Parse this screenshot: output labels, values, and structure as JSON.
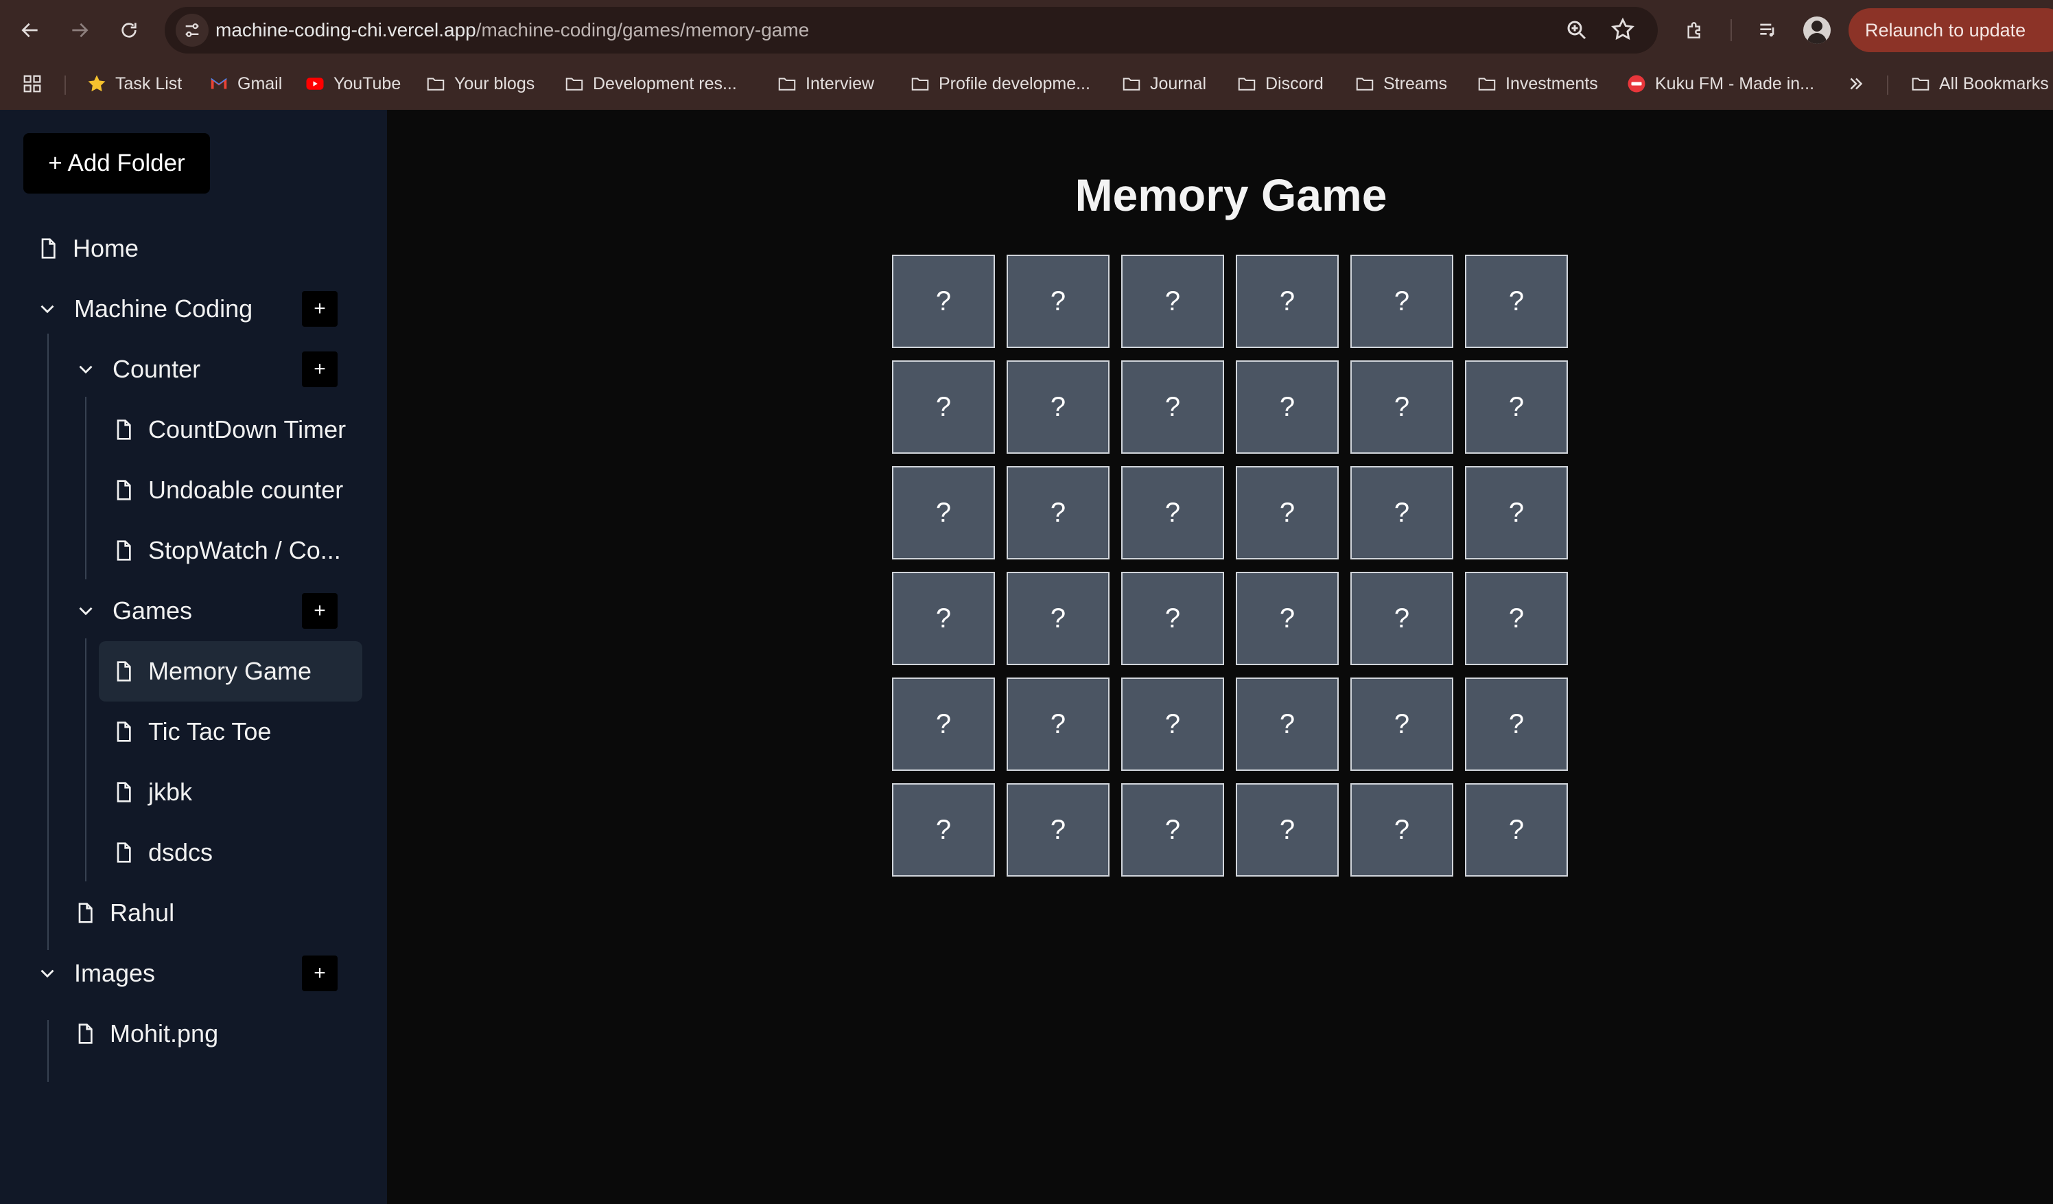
{
  "browser": {
    "url_host": "machine-coding-chi.vercel.app",
    "url_path": "/machine-coding/games/memory-game",
    "relaunch_label": "Relaunch to update",
    "bookmarks": [
      {
        "label": "Task List",
        "icon": "star-icon"
      },
      {
        "label": "Gmail",
        "icon": "gmail-icon"
      },
      {
        "label": "YouTube",
        "icon": "youtube-icon"
      },
      {
        "label": "Your blogs",
        "icon": "folder-icon"
      },
      {
        "label": "Development res...",
        "icon": "folder-icon"
      },
      {
        "label": "Interview",
        "icon": "folder-icon"
      },
      {
        "label": "Profile developme...",
        "icon": "folder-icon"
      },
      {
        "label": "Journal",
        "icon": "folder-icon"
      },
      {
        "label": "Discord",
        "icon": "folder-icon"
      },
      {
        "label": "Streams",
        "icon": "folder-icon"
      },
      {
        "label": "Investments",
        "icon": "folder-icon"
      },
      {
        "label": "Kuku FM - Made in...",
        "icon": "kukufm-icon"
      }
    ],
    "all_bookmarks_label": "All Bookmarks"
  },
  "sidebar": {
    "add_folder_label": "+ Add Folder",
    "plus_label": "+",
    "items": {
      "home": "Home",
      "machine_coding": "Machine Coding",
      "counter": "Counter",
      "countdown_timer": "CountDown Timer",
      "undoable_counter": "Undoable counter",
      "stopwatch": "StopWatch / Co...",
      "games": "Games",
      "memory_game": "Memory Game",
      "tic_tac_toe": "Tic Tac Toe",
      "jkbk": "jkbk",
      "dsdcs": "dsdcs",
      "rahul": "Rahul",
      "images": "Images",
      "mohit_png": "Mohit.png"
    }
  },
  "main": {
    "title": "Memory Game",
    "grid_rows": 6,
    "grid_cols": 6,
    "card_face": "?"
  },
  "colors": {
    "card_bg": "#4b5563",
    "sidebar_bg": "#111827",
    "main_bg": "#0a0a0a",
    "relaunch_bg": "#8c3327"
  }
}
